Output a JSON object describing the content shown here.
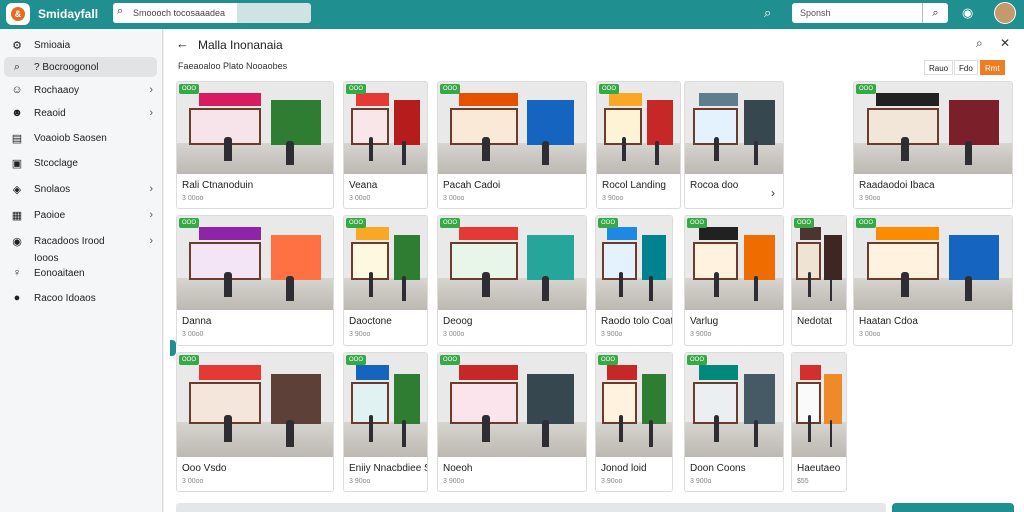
{
  "app": {
    "title": "Smidayfall",
    "logo_icon": "&",
    "search_placeholder": "Smoooch tocosaaadea",
    "search2_placeholder": "Sponsh"
  },
  "sidebar": {
    "items": [
      {
        "label": "Smioaia",
        "icon": "gear-icon",
        "glyph": "⚙",
        "arrow": false,
        "active": false
      },
      {
        "label": "? Bocroogonol",
        "icon": "search-icon",
        "glyph": "⌕",
        "arrow": false,
        "active": true
      },
      {
        "label": "Rochaaoy",
        "icon": "people-icon",
        "glyph": "☺",
        "arrow": true,
        "active": false
      },
      {
        "label": "Reaoid",
        "icon": "user-icon",
        "glyph": "☻",
        "arrow": true,
        "active": false
      },
      {
        "label": "Voaoiob Saosen",
        "icon": "document-icon",
        "glyph": "▤",
        "arrow": false,
        "active": false
      },
      {
        "label": "Stcoclage",
        "icon": "image-icon",
        "glyph": "▣",
        "arrow": false,
        "active": false
      },
      {
        "label": "Snolaos",
        "icon": "tag-icon",
        "glyph": "◈",
        "arrow": true,
        "active": false
      },
      {
        "label": "Paoioe",
        "icon": "briefcase-icon",
        "glyph": "▦",
        "arrow": true,
        "active": false
      },
      {
        "label": "Racadoos Irood",
        "icon": "globe-icon",
        "glyph": "◉",
        "arrow": true,
        "active": false
      },
      {
        "label": "Iooos",
        "icon": "",
        "glyph": "",
        "arrow": false,
        "active": false
      },
      {
        "label": "Eonoaitaen",
        "icon": "person-icon",
        "glyph": "♀",
        "arrow": false,
        "active": false
      },
      {
        "label": "Racoo Idoaos",
        "icon": "profile-icon",
        "glyph": "●",
        "arrow": false,
        "active": false
      }
    ]
  },
  "header": {
    "back_glyph": "←",
    "title": "Malla Inonanaia",
    "breadcrumb": "Faeaoaloo Plato  Nooaobes",
    "pills": [
      "Rauo",
      "Fdo",
      "Rmt"
    ]
  },
  "cards": [
    {
      "name": "Rali Ctnanoduin",
      "price": "3 00oo",
      "badge": "OOO",
      "sign": "#d81b60",
      "store": "#f6e4ea",
      "shop": "#2e7d32"
    },
    {
      "name": "Veana",
      "price": "3 00o0",
      "badge": "OOO",
      "sign": "#e53935",
      "store": "#f8e6e8",
      "shop": "#b71c1c"
    },
    {
      "name": "Pacah Cadoi",
      "price": "3 00oo",
      "badge": "OOO",
      "sign": "#e65100",
      "store": "#fbe9d7",
      "shop": "#1565c0"
    },
    {
      "name": "Rocol Landing",
      "price": "3 90oo",
      "badge": "OOO",
      "sign": "#f9a825",
      "store": "#fff3d6",
      "shop": "#c62828"
    },
    {
      "name": "Rocoa doo",
      "price": "",
      "badge": "",
      "sign": "#607d8b",
      "store": "#e3f2fd",
      "shop": "#37474f"
    },
    {
      "name": "Raadaodoi Ibaca",
      "price": "3 90oo",
      "badge": "OOO",
      "sign": "#212121",
      "store": "#f2e6d8",
      "shop": "#7b1f2b"
    },
    {
      "name": "Danna",
      "price": "3 00o0",
      "badge": "OOO",
      "sign": "#8e24aa",
      "store": "#f3e5f5",
      "shop": "#ff7043"
    },
    {
      "name": "Daoctone",
      "price": "3 90oo",
      "badge": "OOO",
      "sign": "#f9a825",
      "store": "#fff8e1",
      "shop": "#2e7d32"
    },
    {
      "name": "Deoog",
      "price": "3 000o",
      "badge": "OOO",
      "sign": "#e53935",
      "store": "#e8f5e9",
      "shop": "#26a69a"
    },
    {
      "name": "Raodo tolo Coat",
      "price": "3 900o",
      "badge": "OOO",
      "sign": "#1e88e5",
      "store": "#e3f2fd",
      "shop": "#00838f"
    },
    {
      "name": "Varlug",
      "price": "3 900o",
      "badge": "OOO",
      "sign": "#212121",
      "store": "#fff3e0",
      "shop": "#ef6c00"
    },
    {
      "name": "Nedotat",
      "price": "",
      "badge": "OOO",
      "sign": "#4e342e",
      "store": "#efe3d3",
      "shop": "#3e2723"
    },
    {
      "name": "Haatan Cdoa",
      "price": "3 00oo",
      "badge": "OOO",
      "sign": "#fb8c00",
      "store": "#fff3e0",
      "shop": "#1565c0"
    },
    {
      "name": "Ooo Vsdo",
      "price": "3 00oo",
      "badge": "OOO",
      "sign": "#e53935",
      "store": "#f5e6dc",
      "shop": "#5d4037"
    },
    {
      "name": "Eniiy Nnacbdiee Senninae",
      "price": "3 90oo",
      "badge": "OOO",
      "sign": "#1565c0",
      "store": "#e0f2f1",
      "shop": "#2e7d32"
    },
    {
      "name": "Noeoh",
      "price": "3 900o",
      "badge": "OOO",
      "sign": "#c62828",
      "store": "#fce4ec",
      "shop": "#37474f"
    },
    {
      "name": "Jonod loid",
      "price": "3 90oo",
      "badge": "OOO",
      "sign": "#c62828",
      "store": "#fff3e0",
      "shop": "#2e7d32"
    },
    {
      "name": "Doon Coons",
      "price": "3 900o",
      "badge": "OOO",
      "sign": "#00897b",
      "store": "#eceff1",
      "shop": "#455a64"
    },
    {
      "name": "Haeutaeo",
      "price": "$55",
      "badge": "",
      "sign": "#d32f2f",
      "store": "#fafafa",
      "shop": "#ef8a2a"
    }
  ],
  "colors": {
    "brand": "#1f8f8f",
    "accent": "#ef7d24",
    "badge": "#37a847"
  }
}
